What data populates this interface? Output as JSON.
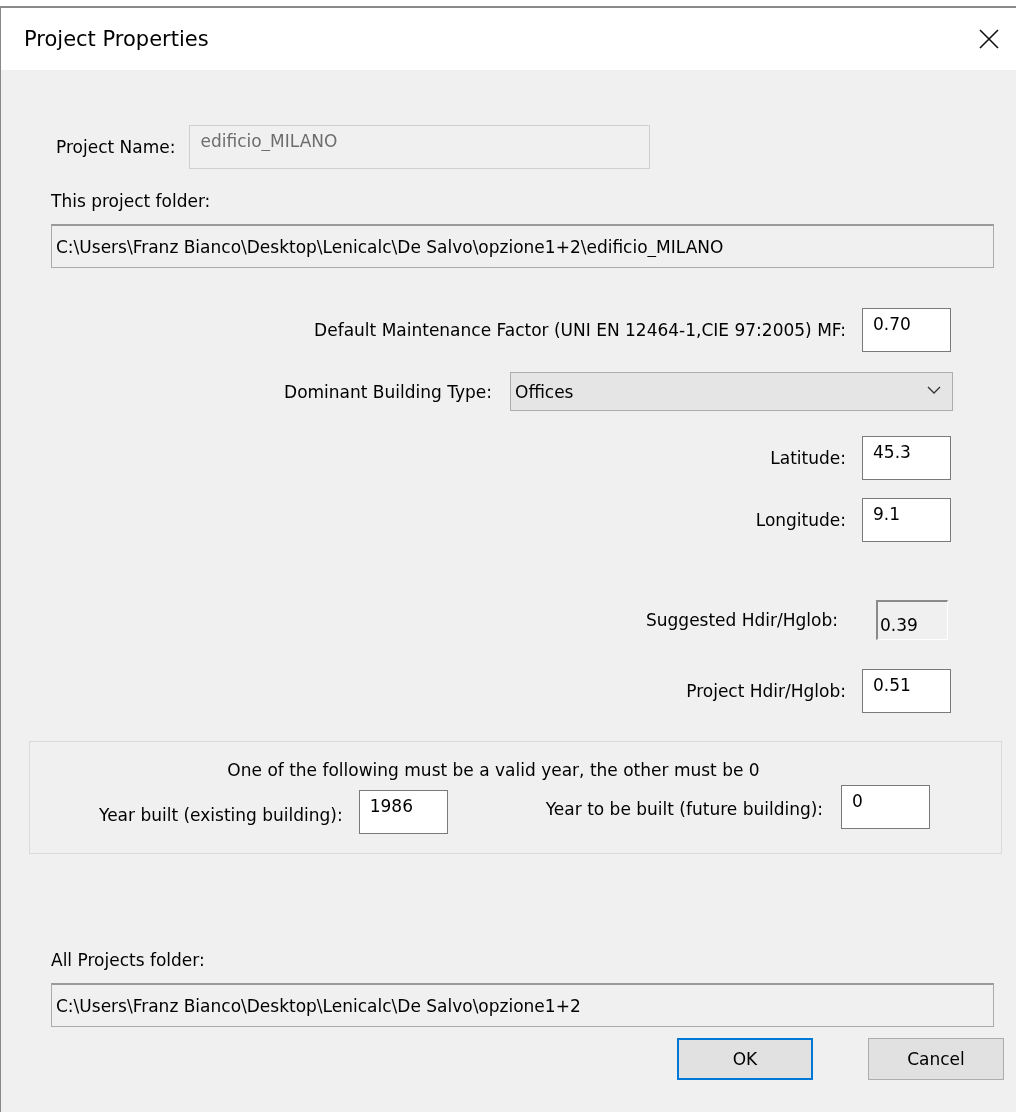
{
  "window": {
    "title": "Project Properties"
  },
  "project_name": {
    "label": "Project Name:",
    "value": "edificio_MILANO",
    "disabled": true
  },
  "project_folder": {
    "label": "This project folder:",
    "value": "C:\\Users\\Franz Bianco\\Desktop\\Lenicalc\\De Salvo\\opzione1+2\\edificio_MILANO",
    "disabled": true
  },
  "settings": [
    {
      "kind": "input",
      "label": "Default Maintenance Factor (UNI EN 12464-1,CIE 97:2005) MF:",
      "value": "0.70",
      "disabled": false
    },
    {
      "kind": "dropdown",
      "label": "Dominant Building Type:",
      "value": "Offices",
      "disabled": false
    },
    {
      "kind": "input",
      "label": "Latitude:",
      "value": "45.3",
      "disabled": false
    },
    {
      "kind": "input",
      "label": "Longitude:",
      "value": "9.1",
      "disabled": false
    },
    {
      "kind": "readonly",
      "label": "Suggested Hdir/Hglob:",
      "value": "0.39",
      "disabled": true
    },
    {
      "kind": "input",
      "label": "Project Hdir/Hglob:",
      "value": "0.51",
      "disabled": false
    }
  ],
  "year_group": {
    "note": "One of the following must be a valid year, the other must be 0",
    "fields": [
      {
        "label": "Year built (existing building):",
        "value": "1986"
      },
      {
        "label": "Year to be built (future building):",
        "value": "0"
      }
    ]
  },
  "all_projects_folder": {
    "label": "All Projects folder:",
    "value": "C:\\Users\\Franz Bianco\\Desktop\\Lenicalc\\De Salvo\\opzione1+2",
    "disabled": true
  },
  "buttons": [
    {
      "label": "OK",
      "default": true
    },
    {
      "label": "Cancel",
      "default": false
    }
  ]
}
